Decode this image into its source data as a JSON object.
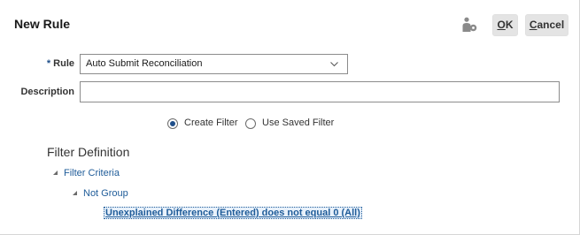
{
  "dialog": {
    "title": "New Rule"
  },
  "toolbar": {
    "ok_accel": "O",
    "ok_rest": "K",
    "cancel_accel": "C",
    "cancel_rest": "ancel",
    "user_icon": "user-settings-icon"
  },
  "form": {
    "rule": {
      "required_marker": "*",
      "label": "Rule",
      "value": "Auto Submit Reconciliation"
    },
    "description": {
      "label": "Description",
      "value": ""
    }
  },
  "filter_mode": {
    "options": [
      {
        "label": "Create Filter",
        "selected": true
      },
      {
        "label": "Use Saved Filter",
        "selected": false
      }
    ]
  },
  "filter_definition": {
    "title": "Filter Definition",
    "criteria_label": "Filter Criteria",
    "group_label": "Not Group",
    "condition": "Unexplained Difference (Entered) does not equal 0 (All)"
  },
  "colors": {
    "accent": "#1f4f8a",
    "link": "#1f5c99",
    "button_bg": "#e4e4e4"
  }
}
